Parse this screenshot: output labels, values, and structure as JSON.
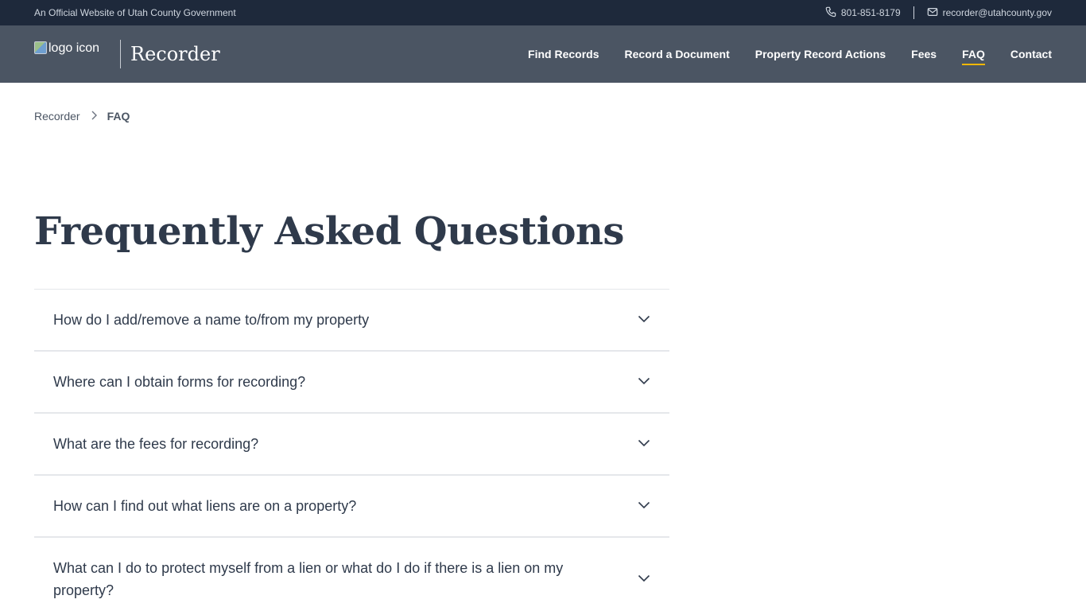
{
  "topbar": {
    "official_text": "An Official Website of Utah County Government",
    "phone": "801-851-8179",
    "email": "recorder@utahcounty.gov"
  },
  "header": {
    "logo_alt": "logo icon",
    "title": "Recorder",
    "nav": [
      {
        "label": "Find Records"
      },
      {
        "label": "Record a Document"
      },
      {
        "label": "Property Record Actions"
      },
      {
        "label": "Fees"
      },
      {
        "label": "FAQ",
        "active": true
      },
      {
        "label": "Contact"
      }
    ],
    "active_color": "#f5b700"
  },
  "breadcrumb": {
    "parent": "Recorder",
    "current": "FAQ"
  },
  "page": {
    "title": "Frequently Asked Questions"
  },
  "faq": {
    "items": [
      {
        "question": "How do I add/remove a name to/from my property"
      },
      {
        "question": "Where can I obtain forms for recording?"
      },
      {
        "question": "What are the fees for recording?"
      },
      {
        "question": "How can I find out what liens are on a property?"
      },
      {
        "question": "What can I do to protect myself from a lien or what do I do if there is a lien on my property?"
      }
    ]
  },
  "colors": {
    "topbar_bg": "#1e293b",
    "header_bg": "#4b5563",
    "text": "#2f3a4b"
  }
}
